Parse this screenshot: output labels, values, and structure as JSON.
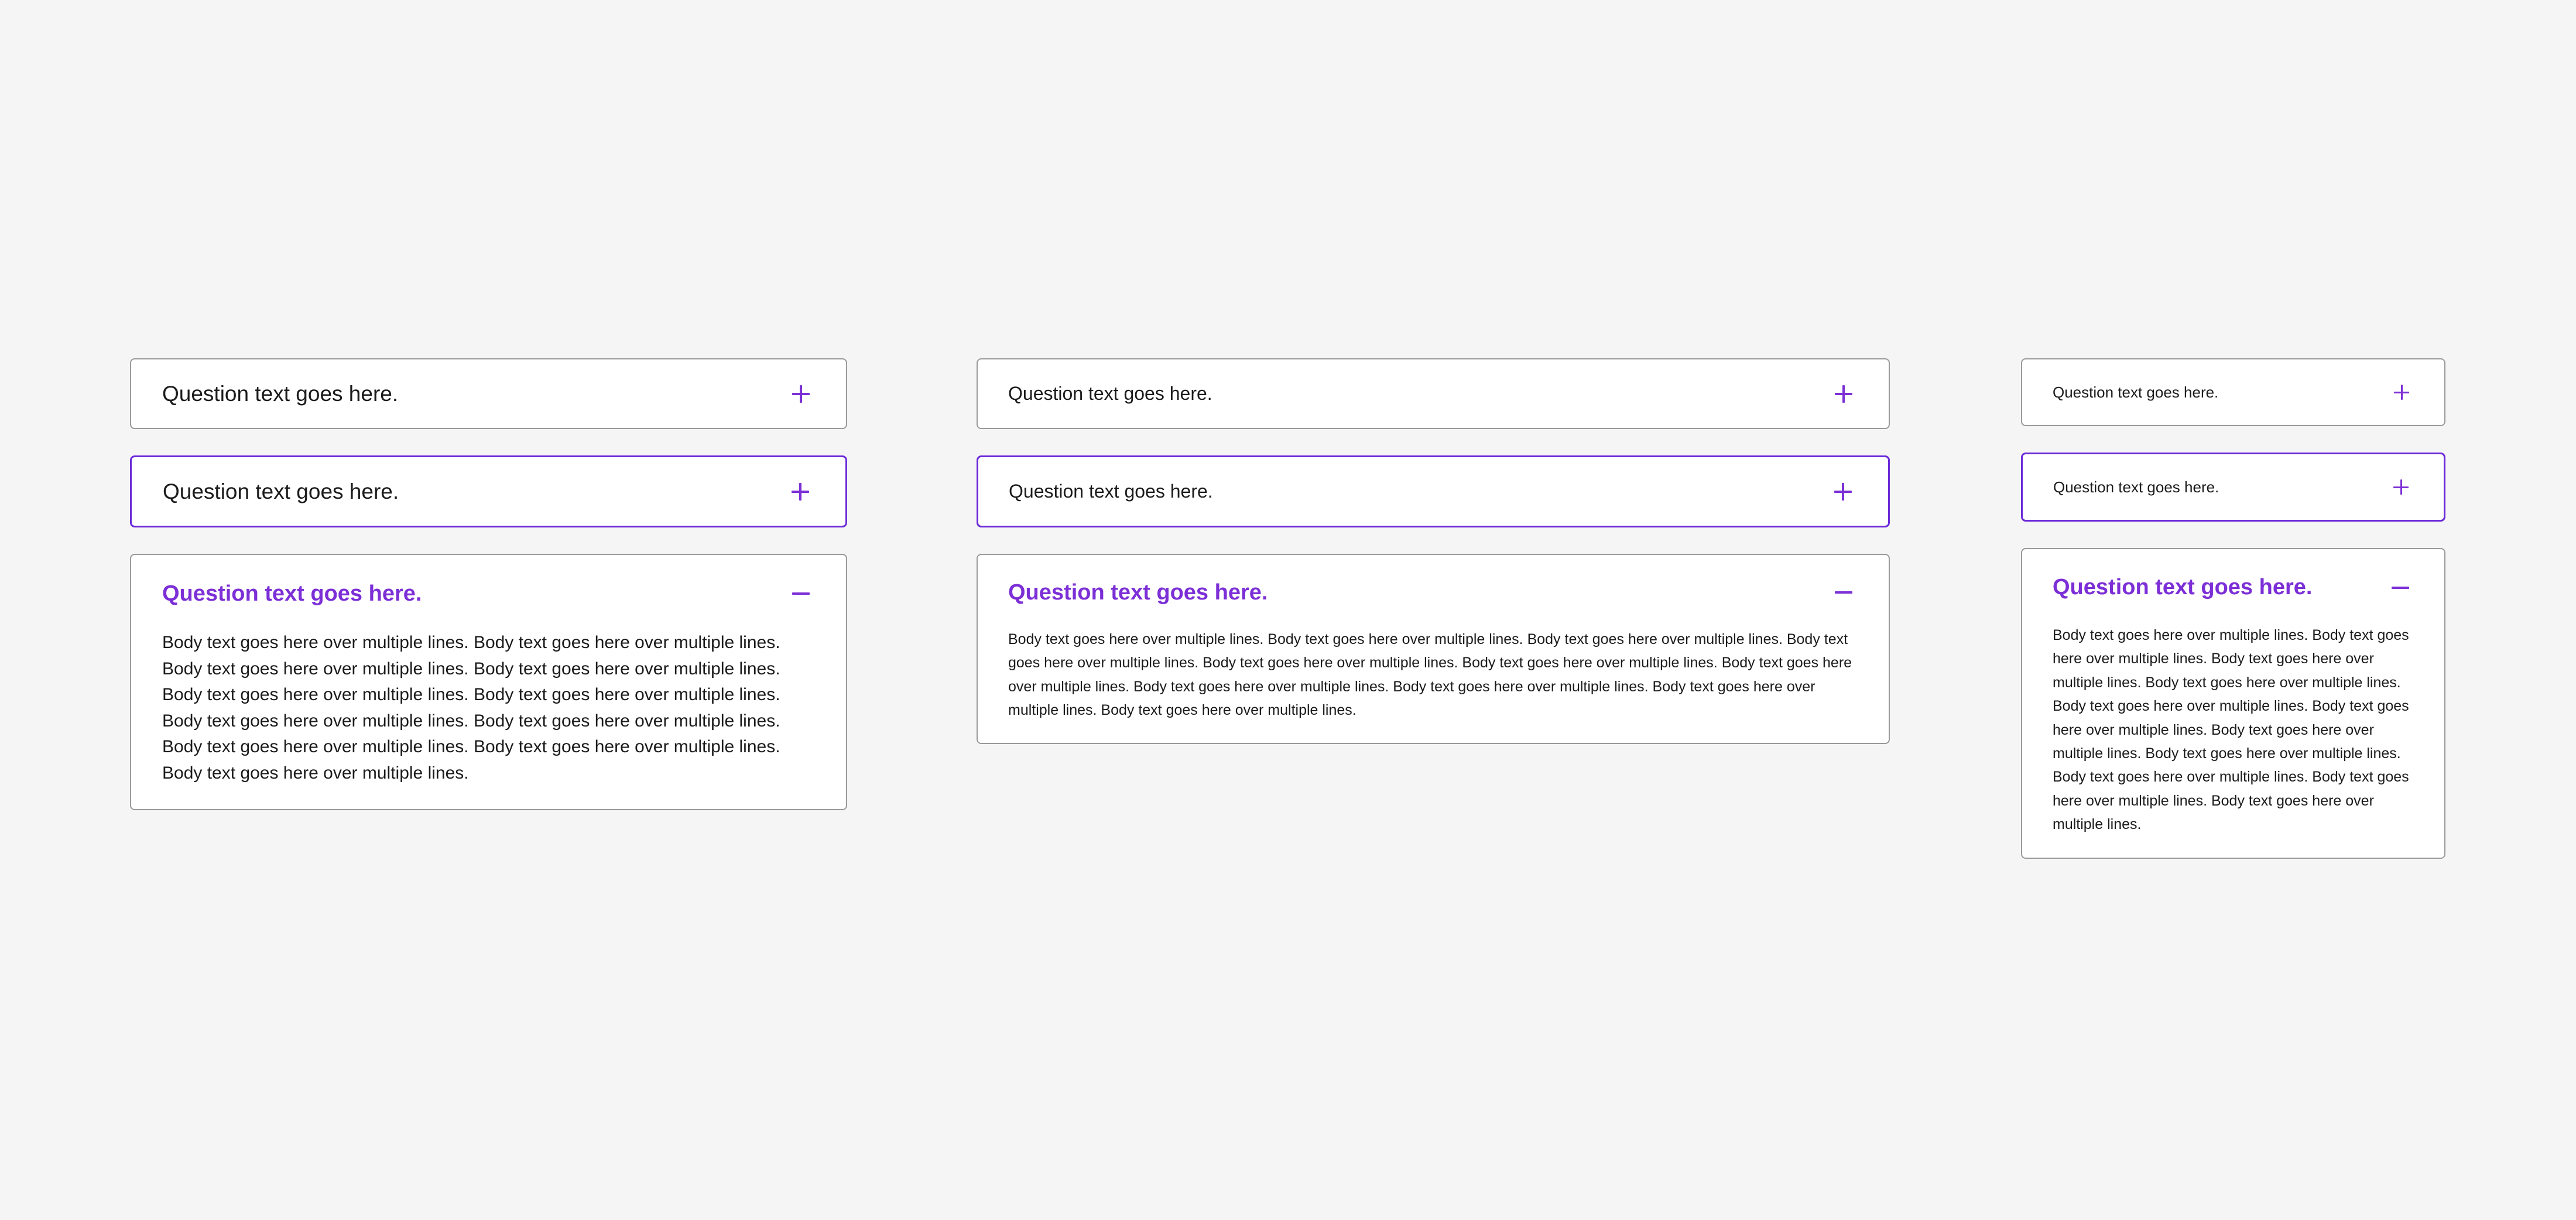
{
  "colors": {
    "background": "#f5f5f5",
    "card": "#ffffff",
    "border": "#9a9a9a",
    "focus_border": "#6c2bd9",
    "accent": "#7c2fd6",
    "text": "#1b1b1b"
  },
  "icons": {
    "collapsed": "plus-icon",
    "expanded": "minus-icon"
  },
  "columns": [
    {
      "size": "large",
      "items": [
        {
          "state": "collapsed",
          "question": "Question text goes here."
        },
        {
          "state": "focused",
          "question": "Question text goes here."
        },
        {
          "state": "expanded",
          "question": "Question text goes here.",
          "answer": "Body text goes here over multiple lines. Body text goes here over multiple lines. Body text goes here over multiple lines. Body text goes here over multiple lines. Body text goes here over multiple lines. Body text goes here over multiple lines. Body text goes here over multiple lines. Body text goes here over multiple lines. Body text goes here over multiple lines. Body text goes here over multiple lines. Body text goes here over multiple lines."
        }
      ]
    },
    {
      "size": "medium",
      "items": [
        {
          "state": "collapsed",
          "question": "Question text goes here."
        },
        {
          "state": "focused",
          "question": "Question text goes here."
        },
        {
          "state": "expanded",
          "question": "Question text goes here.",
          "answer": "Body text goes here over multiple lines. Body text goes here over multiple lines. Body text goes here over multiple lines. Body text goes here over multiple lines. Body text goes here over multiple lines. Body text goes here over multiple lines. Body text goes here over multiple lines. Body text goes here over multiple lines. Body text goes here over multiple lines. Body text goes here over multiple lines. Body text goes here over multiple lines."
        }
      ]
    },
    {
      "size": "small",
      "items": [
        {
          "state": "collapsed",
          "question": "Question text goes here."
        },
        {
          "state": "focused",
          "question": "Question text goes here."
        },
        {
          "state": "expanded",
          "question": "Question text goes here.",
          "answer": "Body text goes here over multiple lines. Body text goes here over multiple lines. Body text goes here over multiple lines. Body text goes here over multiple lines. Body text goes here over multiple lines. Body text goes here over multiple lines. Body text goes here over multiple lines. Body text goes here over multiple lines. Body text goes here over multiple lines. Body text goes here over multiple lines. Body text goes here over multiple lines."
        }
      ]
    }
  ]
}
